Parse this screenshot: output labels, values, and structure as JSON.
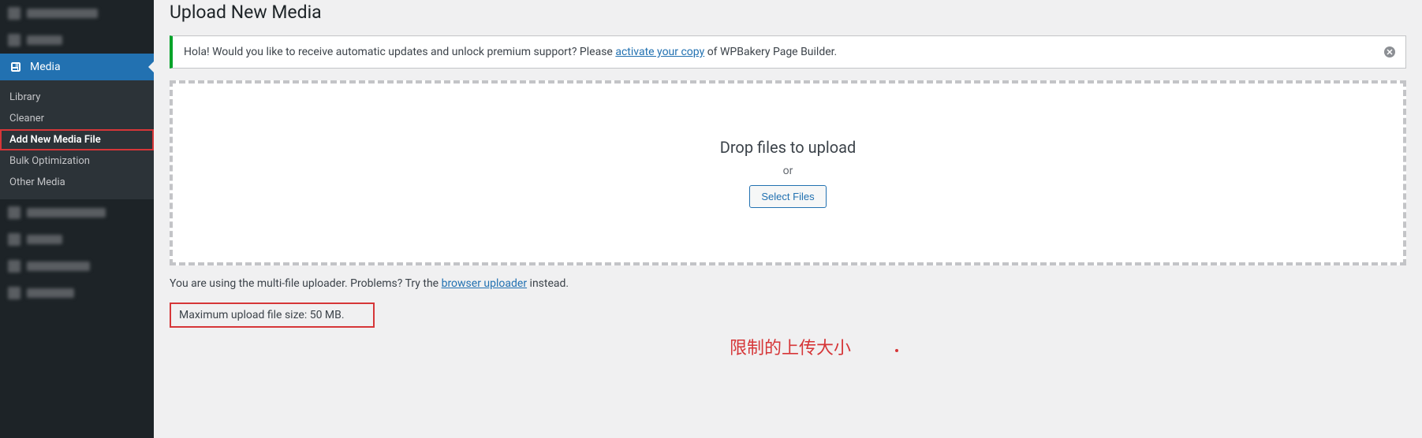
{
  "sidebar": {
    "media_label": "Media",
    "submenu": {
      "library": "Library",
      "cleaner": "Cleaner",
      "add_new": "Add New Media File",
      "bulk_opt": "Bulk Optimization",
      "other": "Other Media"
    }
  },
  "page": {
    "title": "Upload New Media"
  },
  "notice": {
    "text_before": "Hola! Would you like to receive automatic updates and unlock premium support? Please ",
    "link": "activate your copy",
    "text_after": " of WPBakery Page Builder."
  },
  "dropzone": {
    "title": "Drop files to upload",
    "or": "or",
    "button": "Select Files"
  },
  "hint": {
    "before": "You are using the multi-file uploader. Problems? Try the ",
    "link": "browser uploader",
    "after": " instead."
  },
  "max_size": "Maximum upload file size: 50 MB.",
  "annotation": "限制的上传大小"
}
